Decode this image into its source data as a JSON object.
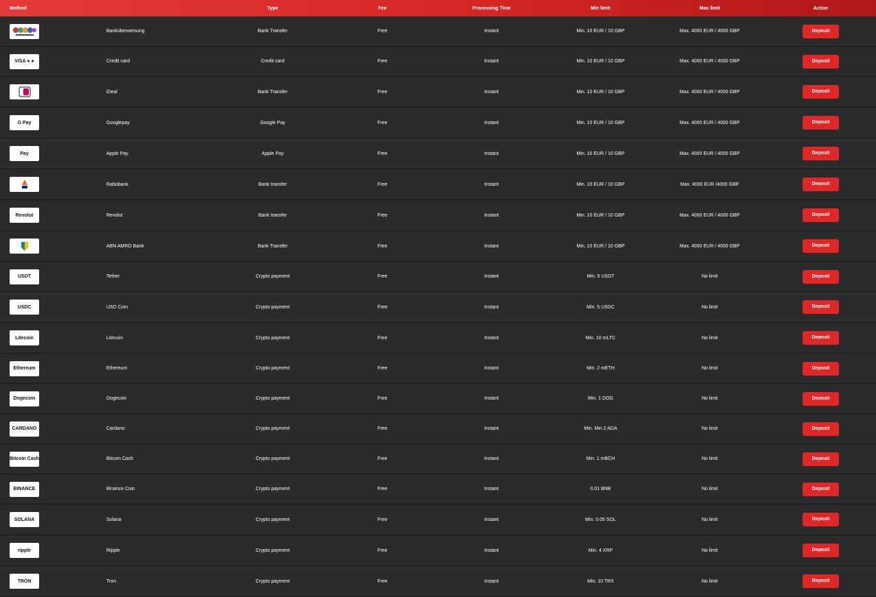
{
  "header": {
    "method": "Method",
    "type": "Type",
    "fee": "Fee",
    "processing_time": "Processing Time",
    "min_limit": "Min limit",
    "max_limit": "Max limit",
    "action": "Action"
  },
  "rows": [
    {
      "name": "Banküberweisung",
      "type": "Bank Transfer",
      "fee": "Free",
      "time": "Instant",
      "min": "Min. 10 EUR / 10 GBP",
      "max": "Max. 4000 EUR / 4000 GBP",
      "action": "Deposit",
      "icon": "bank-transfer-icon"
    },
    {
      "name": "Credit card",
      "type": "Credit card",
      "fee": "Free",
      "time": "Instant",
      "min": "Min. 10 EUR / 10 GBP",
      "max": "Max. 4000 EUR / 4000 GBP",
      "action": "Deposit",
      "icon": "credit-card-icon",
      "logo_text": "VISA ● ●"
    },
    {
      "name": "iDeal",
      "type": "Bank Transfer",
      "fee": "Free",
      "time": "Instant",
      "min": "Min. 10 EUR / 10 GBP",
      "max": "Max. 4000 EUR / 4000 GBP",
      "action": "Deposit",
      "icon": "ideal-icon"
    },
    {
      "name": "Googlepay",
      "type": "Google Pay",
      "fee": "Free",
      "time": "Instant",
      "min": "Min. 10 EUR / 10 GBP",
      "max": "Max. 4000 EUR / 4000 GBP",
      "action": "Deposit",
      "icon": "google-pay-icon",
      "logo_text": "G Pay"
    },
    {
      "name": "Apple Pay",
      "type": "Apple Pay",
      "fee": "Free",
      "time": "Instant",
      "min": "Min. 10 EUR / 10 GBP",
      "max": "Max. 4000 EUR / 4000 GBP",
      "action": "Deposit",
      "icon": "apple-pay-icon",
      "logo_text": "Pay"
    },
    {
      "name": "Rabobank",
      "type": "Bank transfer",
      "fee": "Free",
      "time": "Instant",
      "min": "Min. 10 EUR / 10 GBP",
      "max": "Max. 4000 EUR /4000 GBP",
      "action": "Deposit",
      "icon": "rabobank-icon"
    },
    {
      "name": "Revolut",
      "type": "Bank transfer",
      "fee": "Free",
      "time": "Instant",
      "min": "Min. 10 EUR / 10 GBP",
      "max": "Max. 4000 EUR / 4000 GBP",
      "action": "Deposit",
      "icon": "revolut-icon",
      "logo_text": "Revolut"
    },
    {
      "name": "ABN AMRO Bank",
      "type": "Bank Transfer",
      "fee": "Free",
      "time": "Instant",
      "min": "Min. 10 EUR / 10 GBP",
      "max": "Max. 4000 EUR / 4000 GBP",
      "action": "Deposit",
      "icon": "abn-amro-icon"
    },
    {
      "name": "Tether",
      "type": "Crypto payment",
      "fee": "Free",
      "time": "Instant",
      "min": "Min. 5 USDT",
      "max": "No limit",
      "action": "Deposit",
      "icon": "tether-icon",
      "logo_text": "USDT"
    },
    {
      "name": "USD Coin",
      "type": "Crypto payment",
      "fee": "Free",
      "time": "Instant",
      "min": "Min. 5 USDC",
      "max": "No limit",
      "action": "Deposit",
      "icon": "usd-coin-icon",
      "logo_text": "USDC"
    },
    {
      "name": "Litecoin",
      "type": "Crypto payment",
      "fee": "Free",
      "time": "Instant",
      "min": "Min. 10 mLTC",
      "max": "No limit",
      "action": "Deposit",
      "icon": "litecoin-icon",
      "logo_text": "Litecoin"
    },
    {
      "name": "Ethereum",
      "type": "Crypto payment",
      "fee": "Free",
      "time": "Instant",
      "min": "Min. 2 mETH",
      "max": "No limit",
      "action": "Deposit",
      "icon": "ethereum-icon",
      "logo_text": "Ethereum"
    },
    {
      "name": "Dogecoin",
      "type": "Crypto payment",
      "fee": "Free",
      "time": "Instant",
      "min": "Min. 1 DOG",
      "max": "No limit",
      "action": "Deposit",
      "icon": "dogecoin-icon",
      "logo_text": "Dogecoin"
    },
    {
      "name": "Cardano",
      "type": "Crypto payment",
      "fee": "Free",
      "time": "Instant",
      "min": "Min. Min 2 ADA",
      "max": "No limit",
      "action": "Deposit",
      "icon": "cardano-icon",
      "logo_text": "CARDANO"
    },
    {
      "name": "Bitcoin Cash",
      "type": "Crypto payment",
      "fee": "Free",
      "time": "Instant",
      "min": "Min. 1 mBCH",
      "max": "No limit",
      "action": "Deposit",
      "icon": "bitcoin-cash-icon",
      "logo_text": "Bitcoin Cash"
    },
    {
      "name": "Binance Coin",
      "type": "Crypto payment",
      "fee": "Free",
      "time": "Instant",
      "min": "0.01 BNB",
      "max": "No limit",
      "action": "Deposit",
      "icon": "binance-icon",
      "logo_text": "BINANCE"
    },
    {
      "name": "Solana",
      "type": "Crypto payment",
      "fee": "Free",
      "time": "Instant",
      "min": "Min. 0.05 SOL",
      "max": "No limit",
      "action": "Deposit",
      "icon": "solana-icon",
      "logo_text": "SOLANA"
    },
    {
      "name": "Ripple",
      "type": "Crypto payment",
      "fee": "Free",
      "time": "Instant",
      "min": "Min. 4 XRP",
      "max": "No limit",
      "action": "Deposit",
      "icon": "ripple-icon",
      "logo_text": "ripple"
    },
    {
      "name": "Tron",
      "type": "Crypto payment",
      "fee": "Free",
      "time": "Instant",
      "min": "Min. 10 TRX",
      "max": "No limit",
      "action": "Deposit",
      "icon": "tron-icon",
      "logo_text": "TRON"
    }
  ],
  "colors": {
    "header_start": "#e23a3a",
    "header_end": "#b01818",
    "row_bg": "#2b2b2b",
    "button": "#e02727"
  }
}
